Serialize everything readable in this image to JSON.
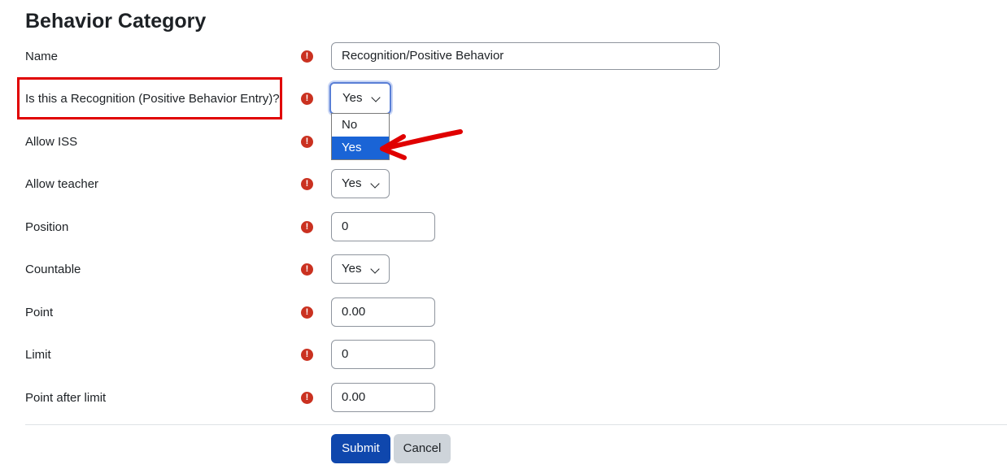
{
  "page": {
    "title": "Behavior Category"
  },
  "required_icon": "exclamation-circle-icon",
  "fields": {
    "name": {
      "label": "Name",
      "value": "Recognition/Positive Behavior"
    },
    "is_recognition": {
      "label": "Is this a Recognition (Positive Behavior Entry)?",
      "value": "Yes",
      "options": [
        "No",
        "Yes"
      ],
      "highlighted_option": "Yes"
    },
    "allow_iss": {
      "label": "Allow ISS"
    },
    "allow_teacher": {
      "label": "Allow teacher",
      "value": "Yes"
    },
    "position": {
      "label": "Position",
      "value": "0"
    },
    "countable": {
      "label": "Countable",
      "value": "Yes"
    },
    "point": {
      "label": "Point",
      "value": "0.00"
    },
    "limit": {
      "label": "Limit",
      "value": "0"
    },
    "point_after_limit": {
      "label": "Point after limit",
      "value": "0.00"
    }
  },
  "buttons": {
    "submit": "Submit",
    "cancel": "Cancel"
  },
  "colors": {
    "accent": "#0f47ad",
    "required": "#ca3120",
    "annotation": "#e00000",
    "option_highlight": "#1a64d6"
  }
}
